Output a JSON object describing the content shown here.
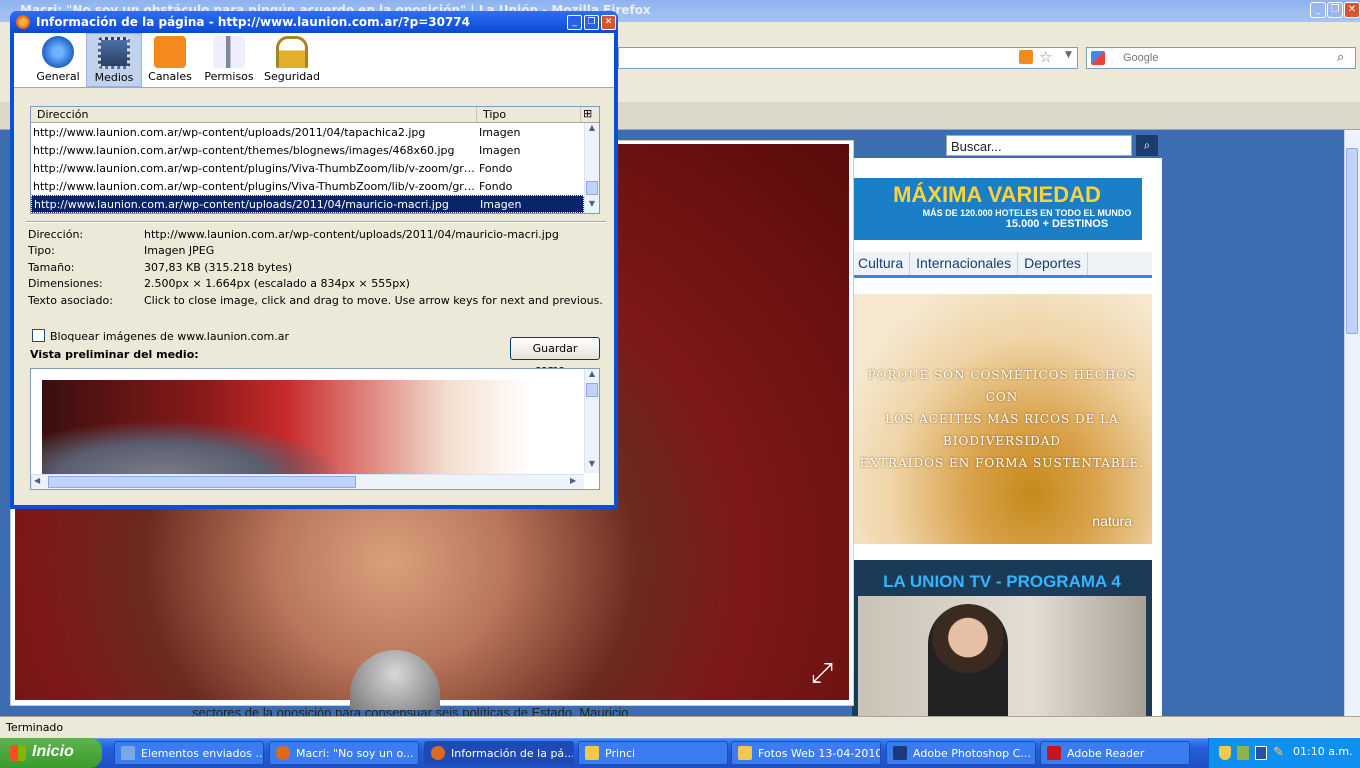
{
  "browser": {
    "title": "Macri: \"No soy un obstáculo para ningún acuerdo en la oposición\" | La Unión - Mozilla Firefox",
    "search_placeholder": "Google",
    "status": "Terminado"
  },
  "site": {
    "search_placeholder": "Buscar...",
    "ad_hotel": {
      "title": "MÁXIMA VARIEDAD",
      "line1": "MÁS DE 120.000 HOTELES EN TODO EL MUNDO",
      "line2": "15.000 + DESTINOS"
    },
    "nav": [
      "Cultura",
      "Internacionales",
      "Deportes"
    ],
    "ad_natura": {
      "line1": "PORQUE SON COSMÉTICOS HECHOS CON",
      "line2": "LOS ACEITES MÁS RICOS DE LA BIODIVERSIDAD",
      "line3": "EXTRAÍDOS EN FORMA SUSTENTABLE.",
      "brand": "natura"
    },
    "tv_title": "LA UNION TV - PROGRAMA 4",
    "caption": "sectores de la oposición para consensuar seis políticas de Estado. Mauricio"
  },
  "dialog": {
    "title": "Información de la página - http://www.launion.com.ar/?p=30774",
    "tabs": [
      {
        "label": "General",
        "icon": "info-icon",
        "color": "#2d7fd8"
      },
      {
        "label": "Medios",
        "icon": "media-icon",
        "color": "#4a6fa8"
      },
      {
        "label": "Canales",
        "icon": "rss-icon",
        "color": "#f28a1e"
      },
      {
        "label": "Permisos",
        "icon": "permissions-icon",
        "color": "#7c8a9e"
      },
      {
        "label": "Seguridad",
        "icon": "lock-icon",
        "color": "#e0b028"
      }
    ],
    "list_headers": {
      "address": "Dirección",
      "type": "Tipo"
    },
    "rows": [
      {
        "address": "http://www.launion.com.ar/wp-content/uploads/2011/04/tapachica2.jpg",
        "type": "Imagen"
      },
      {
        "address": "http://www.launion.com.ar/wp-content/themes/blognews/images/468x60.jpg",
        "type": "Imagen"
      },
      {
        "address": "http://www.launion.com.ar/wp-content/plugins/Viva-ThumbZoom/lib/v-zoom/graphics/loa...",
        "type": "Fondo"
      },
      {
        "address": "http://www.launion.com.ar/wp-content/plugins/Viva-ThumbZoom/lib/v-zoom/graphics/outl...",
        "type": "Fondo"
      },
      {
        "address": "http://www.launion.com.ar/wp-content/uploads/2011/04/mauricio-macri.jpg",
        "type": "Imagen"
      }
    ],
    "props": [
      {
        "key": "Dirección:",
        "value": "http://www.launion.com.ar/wp-content/uploads/2011/04/mauricio-macri.jpg"
      },
      {
        "key": "Tipo:",
        "value": "Imagen JPEG"
      },
      {
        "key": "Tamaño:",
        "value": "307,83 KB (315.218 bytes)"
      },
      {
        "key": "Dimensiones:",
        "value": "2.500px × 1.664px (escalado a 834px × 555px)"
      },
      {
        "key": "Texto asociado:",
        "value": "Click to close image, click and drag to move. Use arrow keys for next and previous."
      }
    ],
    "block_label": "Bloquear imágenes de www.launion.com.ar",
    "save_button": "Guardar como...",
    "preview_label": "Vista preliminar del medio:"
  },
  "taskbar": {
    "start": "Inicio",
    "tasks": [
      {
        "label": "Elementos enviados ...",
        "icon_color": "#7aa7e8"
      },
      {
        "label": "Macri: \"No soy un o...",
        "icon_color": "#e06a1a"
      },
      {
        "label": "Información de la pá...",
        "icon_color": "#e06a1a"
      },
      {
        "label": "Princi",
        "icon_color": "#f2c94a"
      },
      {
        "label": "Fotos Web 13-04-2010",
        "icon_color": "#f2c94a"
      },
      {
        "label": "Adobe Photoshop C...",
        "icon_color": "#1b3a7a"
      },
      {
        "label": "Adobe Reader",
        "icon_color": "#c4161c"
      }
    ],
    "clock": "01:10 a.m."
  }
}
